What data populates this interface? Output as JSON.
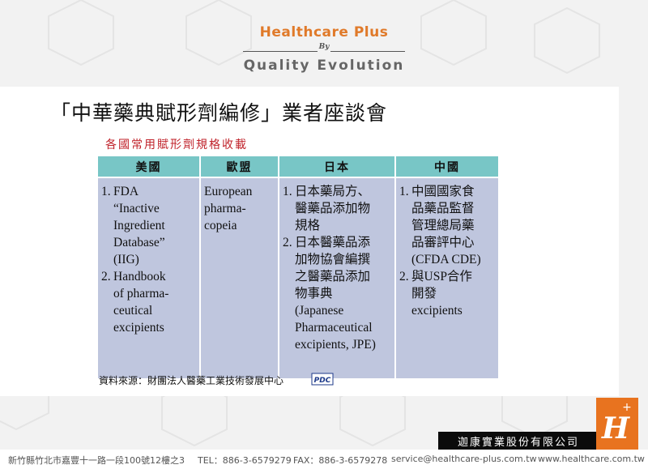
{
  "brand": {
    "title": "Healthcare Plus",
    "by": "By",
    "subtitle": "Quality Evolution",
    "accent_color": "#e07a2a"
  },
  "page_title": "「中華藥典賦形劑編修」業者座談會",
  "table": {
    "caption": "各國常用賦形劑規格收載",
    "headers": [
      "美國",
      "歐盟",
      "日本",
      "中國"
    ],
    "header_color": "#78c6c6",
    "cell_color": "#bfc6de",
    "columns": [
      {
        "items": [
          {
            "num": "1.",
            "lines": [
              "FDA",
              "“Inactive",
              "Ingredient",
              "Database”",
              "(IIG)"
            ]
          },
          {
            "num": "2.",
            "lines": [
              "Handbook",
              "of pharma-",
              "ceutical",
              "excipients"
            ]
          }
        ]
      },
      {
        "plain": [
          "European",
          "pharma-",
          "copeia"
        ]
      },
      {
        "items": [
          {
            "num": "1.",
            "lines": [
              "日本藥局方、",
              "醫藥品添加物",
              "規格"
            ]
          },
          {
            "num": "2.",
            "lines": [
              "日本醫藥品添",
              "加物協會編撰",
              "之醫藥品添加",
              "物事典",
              "(Japanese",
              "Pharmaceutical",
              "excipients, JPE)"
            ]
          }
        ]
      },
      {
        "items": [
          {
            "num": "1.",
            "lines": [
              "中國國家食",
              "品藥品監督",
              "管理總局藥",
              "品審評中心",
              "(CFDA CDE)"
            ]
          },
          {
            "num": "2.",
            "lines": [
              "與USP合作",
              "開發",
              "excipients"
            ]
          }
        ]
      }
    ]
  },
  "source_text": "資料來源：財團法人醫藥工業技術發展中心",
  "source_logo_text": "PDC",
  "company_name": "迦康實業股份有限公司",
  "logo_letter": "H",
  "logo_plus": "+",
  "footer": {
    "address": "新竹縣竹北市嘉豐十一路一段100號12樓之3",
    "tel": "TEL：886-3-6579279",
    "fax": "FAX：886-3-6579278",
    "email": "service@healthcare-plus.com.tw",
    "website": "www.healthcare.com.tw"
  }
}
